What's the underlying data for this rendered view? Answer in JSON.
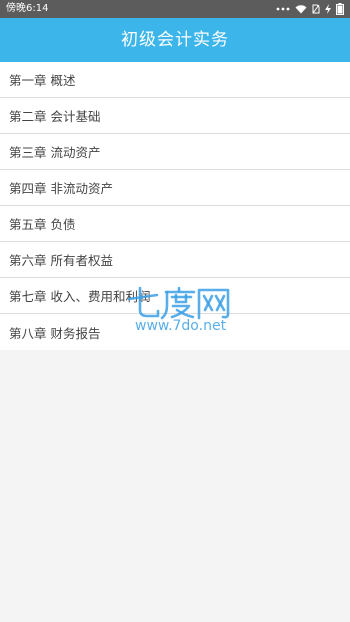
{
  "status_bar": {
    "time": "傍晚6:14",
    "icons": [
      "signal-dots-icon",
      "wifi-icon",
      "no-sim-icon",
      "charging-icon",
      "battery-icon"
    ]
  },
  "header": {
    "title": "初级会计实务"
  },
  "chapters": [
    "第一章 概述",
    "第二章 会计基础",
    "第三章 流动资产",
    "第四章 非流动资产",
    "第五章 负债",
    "第六章 所有者权益",
    "第七章 收入、费用和利润",
    "第八章 财务报告"
  ],
  "watermark": {
    "logo_text": "七度网",
    "url": "www.7do.net"
  },
  "colors": {
    "header_bg": "#3cb6ea",
    "status_bg": "#5c5c5c",
    "list_bg": "#ffffff",
    "page_bg": "#f4f4f4",
    "divider": "#dcdcdc",
    "watermark": "#3ca0e6"
  }
}
